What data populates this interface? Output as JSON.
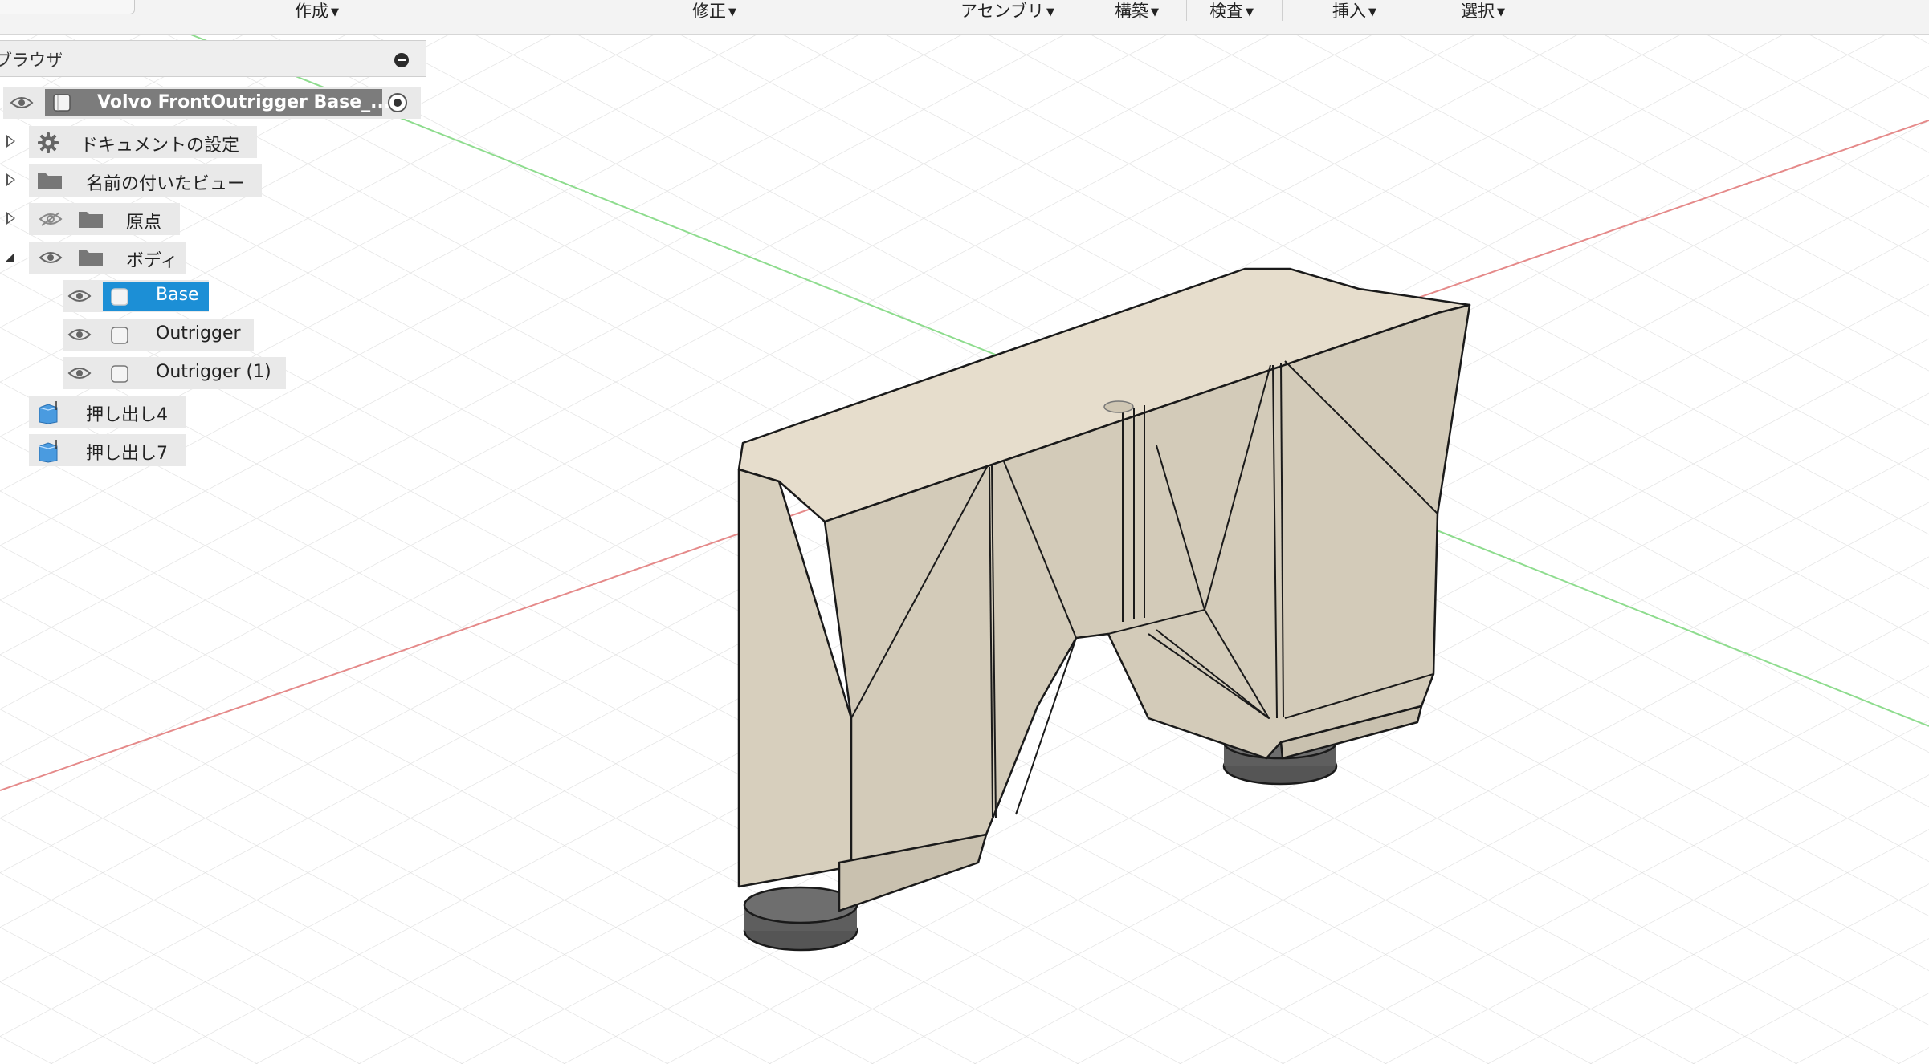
{
  "toolbar": {
    "menus": [
      {
        "label": "作成"
      },
      {
        "label": "修正"
      },
      {
        "label": "アセンブリ"
      },
      {
        "label": "構築"
      },
      {
        "label": "検査"
      },
      {
        "label": "挿入"
      },
      {
        "label": "選択"
      }
    ]
  },
  "browser": {
    "title": "ブラウザ",
    "root": {
      "label": "Volvo FrontOutrigger Base_..."
    },
    "document_settings": {
      "label": "ドキュメントの設定",
      "icon": "gear-icon"
    },
    "named_views": {
      "label": "名前の付いたビュー",
      "icon": "folder-icon"
    },
    "origin": {
      "label": "原点",
      "icon": "folder-icon",
      "visibility": "hidden"
    },
    "bodies_folder": {
      "label": "ボディ",
      "icon": "folder-icon"
    },
    "bodies": [
      {
        "label": "Base",
        "selected": true
      },
      {
        "label": "Outrigger",
        "selected": false
      },
      {
        "label": "Outrigger (1)",
        "selected": false
      }
    ],
    "features": [
      {
        "label": "押し出し4"
      },
      {
        "label": "押し出し7"
      }
    ]
  },
  "colors": {
    "selection": "#1c8fd6",
    "axis_x": "#e06060",
    "axis_y": "#6ccf6c",
    "model_face": "#d6cfbe",
    "grid": "#dcdcdc"
  }
}
